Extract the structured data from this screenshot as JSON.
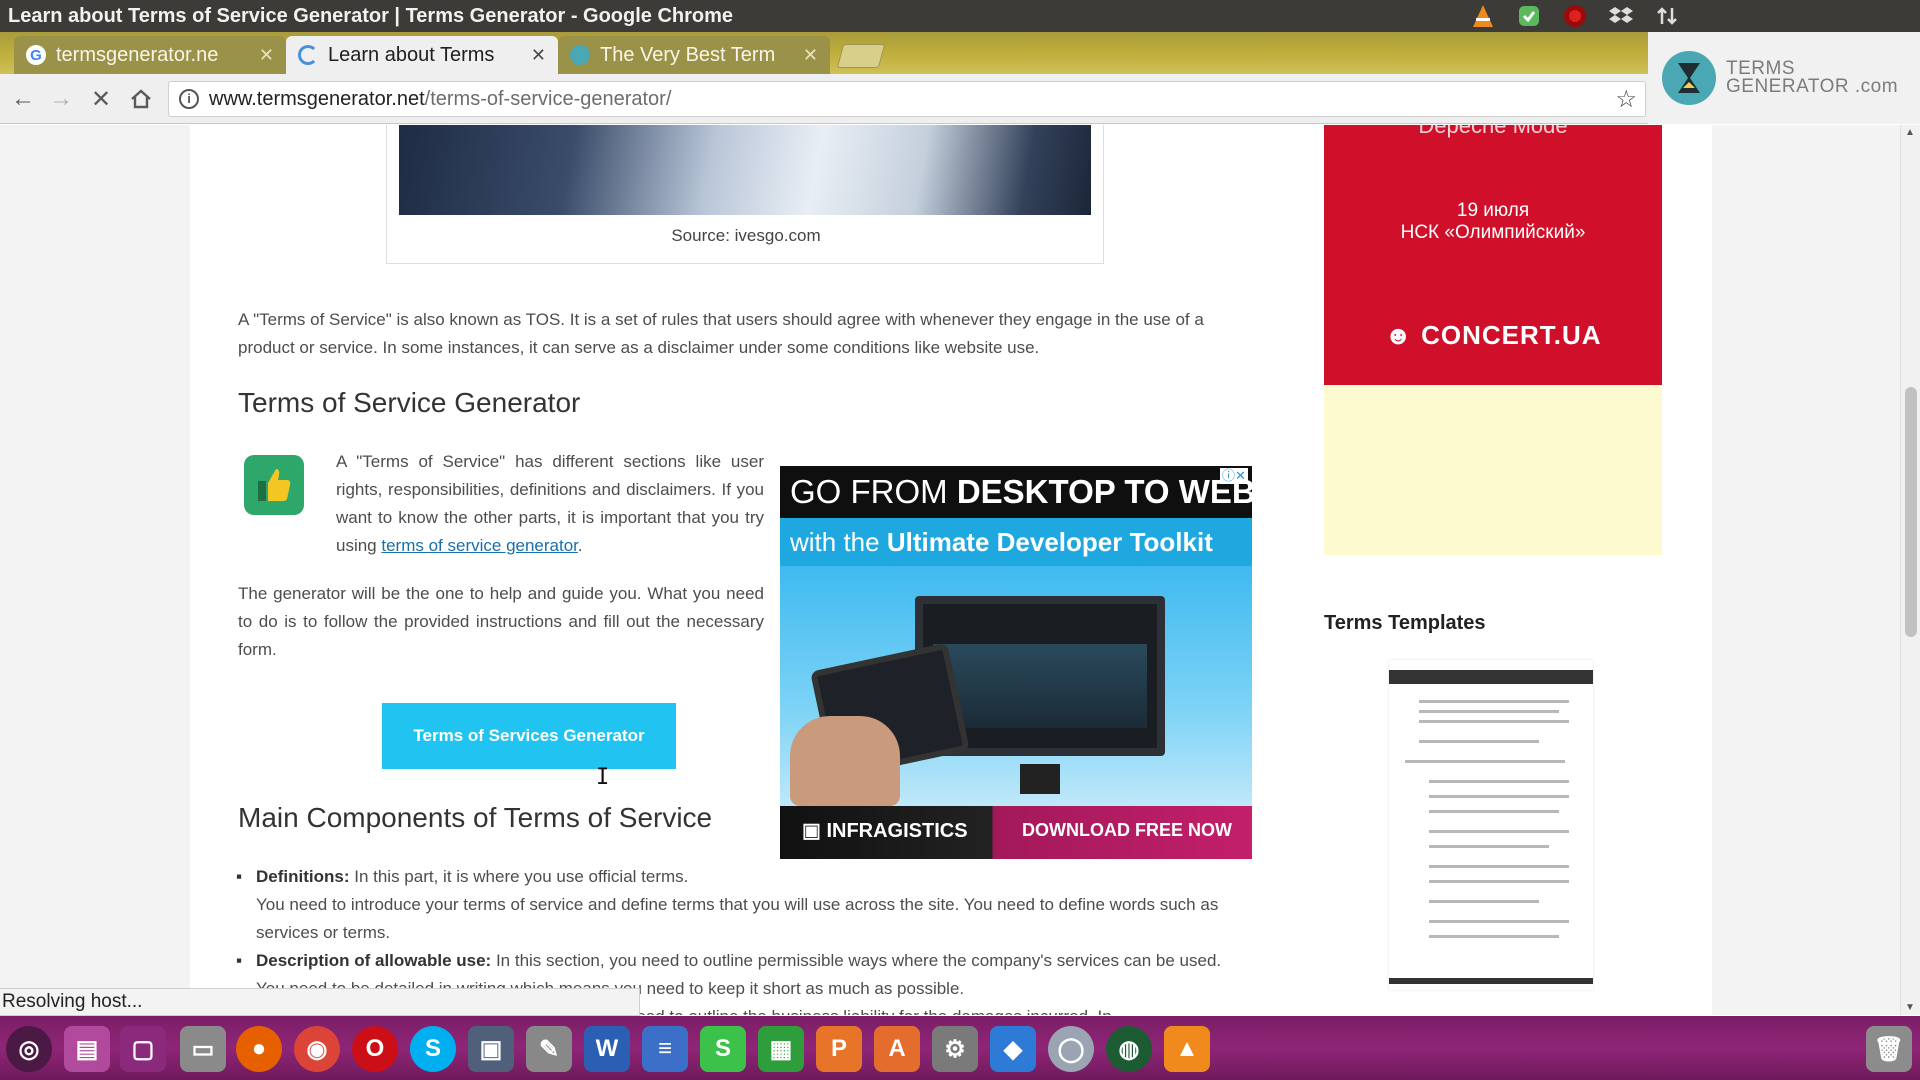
{
  "window": {
    "title": "Learn about Terms of Service Generator | Terms Generator - Google Chrome"
  },
  "tabs": [
    {
      "label": "termsgenerator.ne",
      "state": "inactive",
      "icon": "google-icon"
    },
    {
      "label": "Learn about Terms",
      "state": "active",
      "icon": "loading-icon"
    },
    {
      "label": "The Very Best Term",
      "state": "inactive",
      "icon": "site-icon"
    }
  ],
  "address": {
    "domain": "www.termsgenerator.net",
    "path": "/terms-of-service-generator/"
  },
  "extension": {
    "line1": "TERMS",
    "line2": "GENERATOR .com"
  },
  "article": {
    "image_caption": "Source: ivesgo.com",
    "intro": "A \"Terms of Service\" is also known as TOS. It is a set of rules that users should agree with whenever they engage in the use of a product or service. In some instances, it can serve as a disclaimer under some conditions like website use.",
    "heading1": "Terms of Service Generator",
    "sections_text": "A \"Terms of Service\" has different sections like user rights, responsibilities, definitions and disclaimers. If you want to know the other parts, it is important that you try using ",
    "sections_link": "terms of service generator",
    "sections_end": ".",
    "guide": "The generator will be the one to help and guide you. What you need to do is to follow the provided instructions and fill out the necessary form.",
    "button": "Terms of Services Generator",
    "heading2": "Main Components of Terms of Service",
    "bullets": [
      {
        "term": "Definitions:",
        "text": " In this part, it is where you use official terms.",
        "extra": "You need to introduce your terms of service and define terms that you will use across the site. You need to define words such as services or terms."
      },
      {
        "term": "Description of allowable use:",
        "text": " In this section, you need to outline permissible ways where the company's services can be used. You need to be detailed in writing which means you need to keep it short as much as possible.",
        "extra": ""
      }
    ],
    "bullet3_fragment": "part, you need to outline the business liability for the damages incurred. In"
  },
  "ad": {
    "line1_light": "GO FROM ",
    "line1_bold": "DESKTOP TO WEB",
    "line2_light": "with the ",
    "line2_bold": "Ultimate Developer Toolkit",
    "brand": "INFRAGISTICS",
    "cta": "DOWNLOAD FREE NOW"
  },
  "sidebar": {
    "concert_top": "Depeche Mode",
    "concert_date": "19 июля",
    "concert_venue": "НСК «Олимпийский»",
    "concert_logo": "CONCERT.UA",
    "templates_title": "Terms Templates"
  },
  "status": "Resolving host...",
  "colors": {
    "button": "#21c4f0",
    "link": "#1a6fa8",
    "concert": "#d0102b",
    "dock": "#8f2577"
  }
}
